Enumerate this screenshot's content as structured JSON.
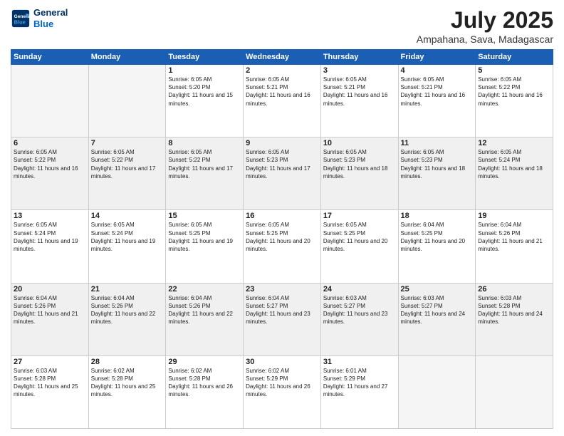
{
  "header": {
    "logo_line1": "General",
    "logo_line2": "Blue",
    "month": "July 2025",
    "location": "Ampahana, Sava, Madagascar"
  },
  "weekdays": [
    "Sunday",
    "Monday",
    "Tuesday",
    "Wednesday",
    "Thursday",
    "Friday",
    "Saturday"
  ],
  "weeks": [
    [
      {
        "day": "",
        "info": ""
      },
      {
        "day": "",
        "info": ""
      },
      {
        "day": "1",
        "info": "Sunrise: 6:05 AM\nSunset: 5:20 PM\nDaylight: 11 hours and 15 minutes."
      },
      {
        "day": "2",
        "info": "Sunrise: 6:05 AM\nSunset: 5:21 PM\nDaylight: 11 hours and 16 minutes."
      },
      {
        "day": "3",
        "info": "Sunrise: 6:05 AM\nSunset: 5:21 PM\nDaylight: 11 hours and 16 minutes."
      },
      {
        "day": "4",
        "info": "Sunrise: 6:05 AM\nSunset: 5:21 PM\nDaylight: 11 hours and 16 minutes."
      },
      {
        "day": "5",
        "info": "Sunrise: 6:05 AM\nSunset: 5:22 PM\nDaylight: 11 hours and 16 minutes."
      }
    ],
    [
      {
        "day": "6",
        "info": "Sunrise: 6:05 AM\nSunset: 5:22 PM\nDaylight: 11 hours and 16 minutes."
      },
      {
        "day": "7",
        "info": "Sunrise: 6:05 AM\nSunset: 5:22 PM\nDaylight: 11 hours and 17 minutes."
      },
      {
        "day": "8",
        "info": "Sunrise: 6:05 AM\nSunset: 5:22 PM\nDaylight: 11 hours and 17 minutes."
      },
      {
        "day": "9",
        "info": "Sunrise: 6:05 AM\nSunset: 5:23 PM\nDaylight: 11 hours and 17 minutes."
      },
      {
        "day": "10",
        "info": "Sunrise: 6:05 AM\nSunset: 5:23 PM\nDaylight: 11 hours and 18 minutes."
      },
      {
        "day": "11",
        "info": "Sunrise: 6:05 AM\nSunset: 5:23 PM\nDaylight: 11 hours and 18 minutes."
      },
      {
        "day": "12",
        "info": "Sunrise: 6:05 AM\nSunset: 5:24 PM\nDaylight: 11 hours and 18 minutes."
      }
    ],
    [
      {
        "day": "13",
        "info": "Sunrise: 6:05 AM\nSunset: 5:24 PM\nDaylight: 11 hours and 19 minutes."
      },
      {
        "day": "14",
        "info": "Sunrise: 6:05 AM\nSunset: 5:24 PM\nDaylight: 11 hours and 19 minutes."
      },
      {
        "day": "15",
        "info": "Sunrise: 6:05 AM\nSunset: 5:25 PM\nDaylight: 11 hours and 19 minutes."
      },
      {
        "day": "16",
        "info": "Sunrise: 6:05 AM\nSunset: 5:25 PM\nDaylight: 11 hours and 20 minutes."
      },
      {
        "day": "17",
        "info": "Sunrise: 6:05 AM\nSunset: 5:25 PM\nDaylight: 11 hours and 20 minutes."
      },
      {
        "day": "18",
        "info": "Sunrise: 6:04 AM\nSunset: 5:25 PM\nDaylight: 11 hours and 20 minutes."
      },
      {
        "day": "19",
        "info": "Sunrise: 6:04 AM\nSunset: 5:26 PM\nDaylight: 11 hours and 21 minutes."
      }
    ],
    [
      {
        "day": "20",
        "info": "Sunrise: 6:04 AM\nSunset: 5:26 PM\nDaylight: 11 hours and 21 minutes."
      },
      {
        "day": "21",
        "info": "Sunrise: 6:04 AM\nSunset: 5:26 PM\nDaylight: 11 hours and 22 minutes."
      },
      {
        "day": "22",
        "info": "Sunrise: 6:04 AM\nSunset: 5:26 PM\nDaylight: 11 hours and 22 minutes."
      },
      {
        "day": "23",
        "info": "Sunrise: 6:04 AM\nSunset: 5:27 PM\nDaylight: 11 hours and 23 minutes."
      },
      {
        "day": "24",
        "info": "Sunrise: 6:03 AM\nSunset: 5:27 PM\nDaylight: 11 hours and 23 minutes."
      },
      {
        "day": "25",
        "info": "Sunrise: 6:03 AM\nSunset: 5:27 PM\nDaylight: 11 hours and 24 minutes."
      },
      {
        "day": "26",
        "info": "Sunrise: 6:03 AM\nSunset: 5:28 PM\nDaylight: 11 hours and 24 minutes."
      }
    ],
    [
      {
        "day": "27",
        "info": "Sunrise: 6:03 AM\nSunset: 5:28 PM\nDaylight: 11 hours and 25 minutes."
      },
      {
        "day": "28",
        "info": "Sunrise: 6:02 AM\nSunset: 5:28 PM\nDaylight: 11 hours and 25 minutes."
      },
      {
        "day": "29",
        "info": "Sunrise: 6:02 AM\nSunset: 5:28 PM\nDaylight: 11 hours and 26 minutes."
      },
      {
        "day": "30",
        "info": "Sunrise: 6:02 AM\nSunset: 5:29 PM\nDaylight: 11 hours and 26 minutes."
      },
      {
        "day": "31",
        "info": "Sunrise: 6:01 AM\nSunset: 5:29 PM\nDaylight: 11 hours and 27 minutes."
      },
      {
        "day": "",
        "info": ""
      },
      {
        "day": "",
        "info": ""
      }
    ]
  ]
}
